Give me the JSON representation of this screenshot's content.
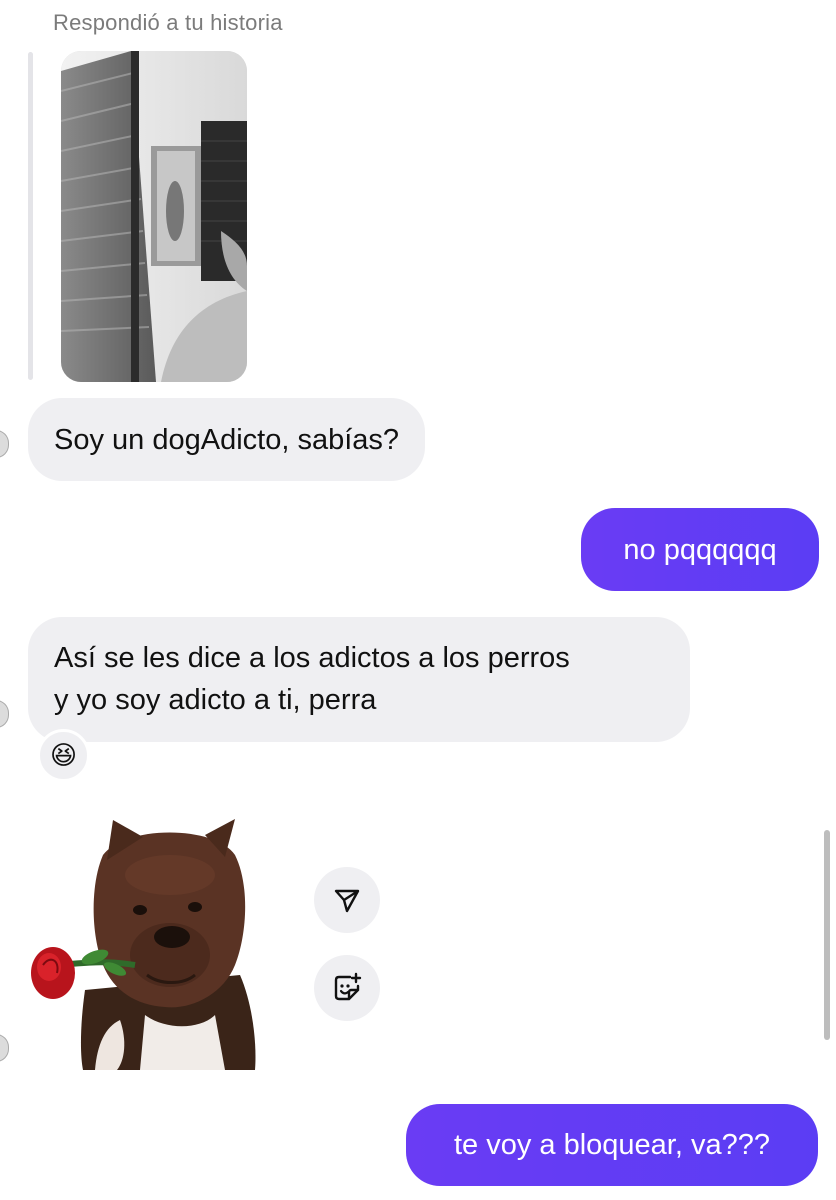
{
  "reply_label": "Respondió a tu historia",
  "messages": [
    {
      "direction": "incoming",
      "text": "Soy un dogAdicto, sabías?"
    },
    {
      "direction": "outgoing",
      "text": "no pqqqqqq"
    },
    {
      "direction": "incoming",
      "line1": "Así se les dice a los adictos a los perros",
      "line2": "y yo soy adicto a ti, perra"
    },
    {
      "direction": "outgoing",
      "text": "te voy a bloquear, va???"
    }
  ],
  "reaction": {
    "emoji": "😆"
  },
  "sticker": {
    "icon": "dog-with-rose-sticker"
  },
  "actions": [
    {
      "icon": "share-icon"
    },
    {
      "icon": "add-sticker-icon"
    }
  ],
  "colors": {
    "outgoing_bubble": "#6a3cf4",
    "incoming_bubble": "#efeff2",
    "reply_label": "#7b7b7b"
  }
}
